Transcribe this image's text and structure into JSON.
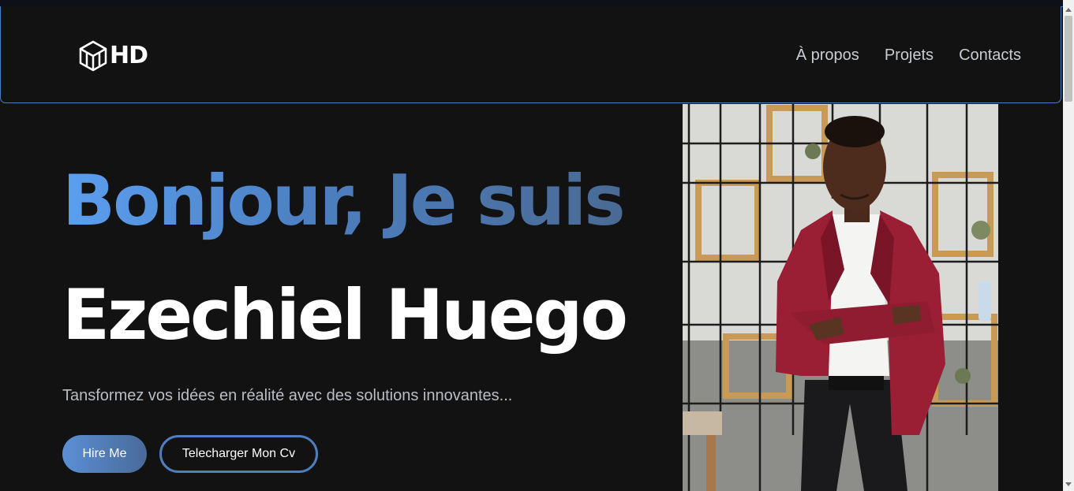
{
  "brand": {
    "logo_text": "HD",
    "logo_icon": "cube-icon"
  },
  "nav": {
    "items": [
      {
        "label": "À propos"
      },
      {
        "label": "Projets"
      },
      {
        "label": "Contacts"
      }
    ]
  },
  "hero": {
    "greeting": "Bonjour, Je suis",
    "name": "Ezechiel Huego",
    "tagline": "Tansformez vos idées en réalité avec des solutions innovantes...",
    "primary_button": "Hire Me",
    "secondary_button": "Telecharger Mon Cv"
  },
  "colors": {
    "background": "#121212",
    "accent_blue": "#5b9ff0",
    "accent_gradient_end": "#4a6a94",
    "nav_border": "#4a7fc0",
    "blazer": "#9a1f35"
  }
}
